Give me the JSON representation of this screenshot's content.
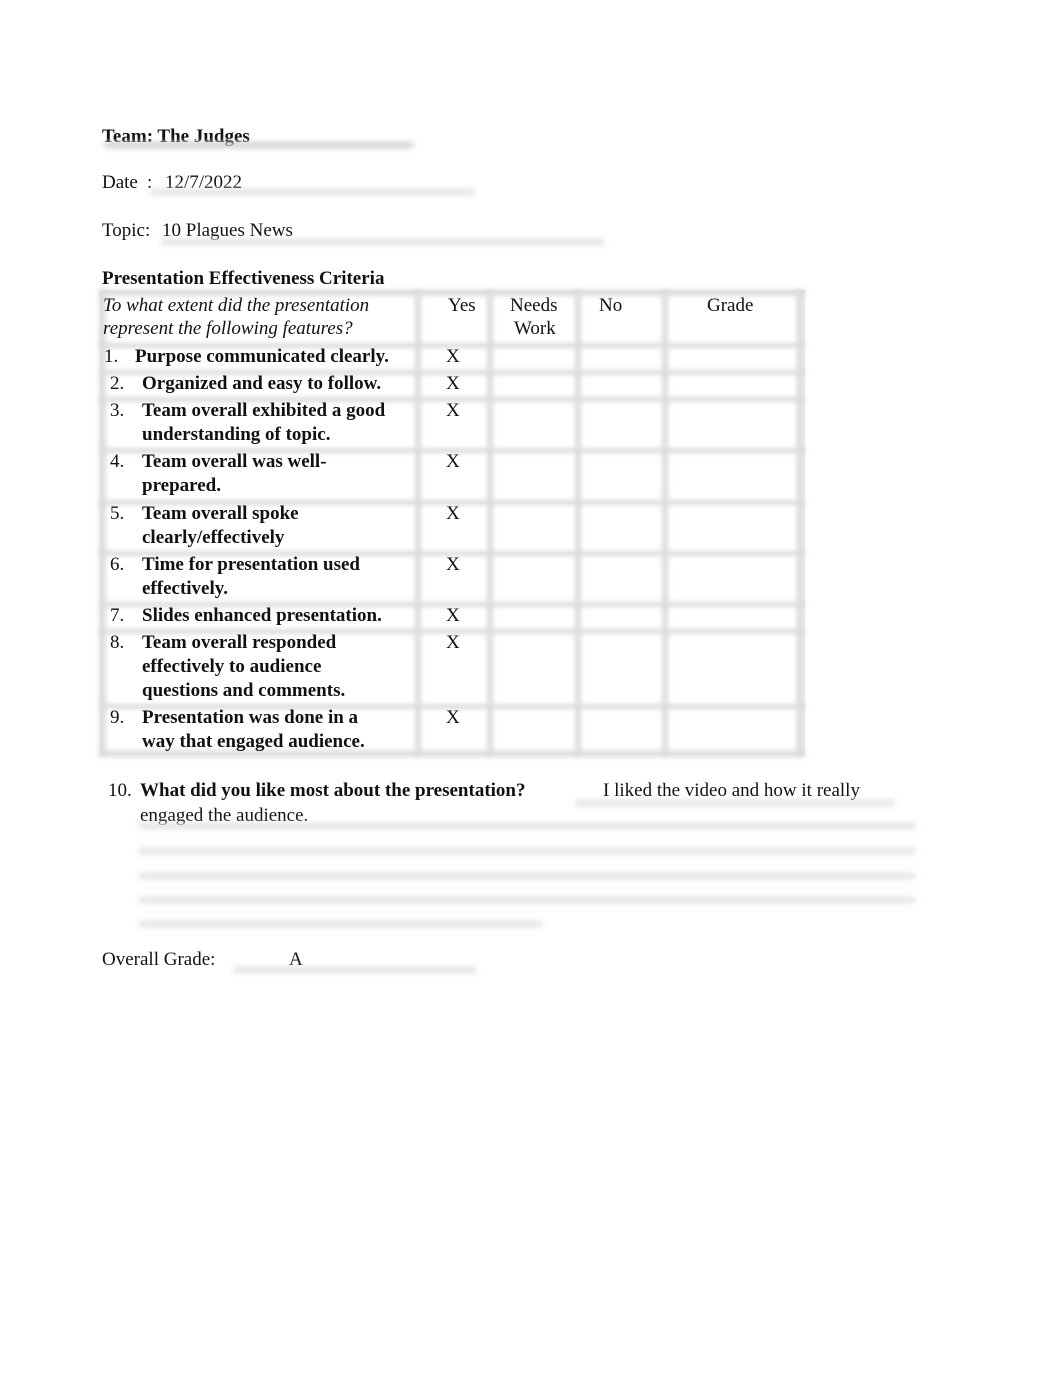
{
  "header": {
    "team_label": "Team: The Judges",
    "date_label": "Date",
    "date_sep": ":",
    "date_value": "12/7/2022",
    "topic_label": "Topic:",
    "topic_value": "10 Plagues News"
  },
  "table": {
    "title": "Presentation Effectiveness Criteria",
    "question_line1": "To what extent did the presentation",
    "question_line2": "represent the following features?",
    "columns": {
      "yes": "Yes",
      "needs_work_1": "Needs",
      "needs_work_2": "Work",
      "no": "No",
      "grade": "Grade"
    },
    "rows": [
      {
        "num": "1.",
        "lines": [
          "Purpose communicated clearly."
        ],
        "yes": "X",
        "needs_work": "",
        "no": "",
        "grade": ""
      },
      {
        "num": "2.",
        "lines": [
          "Organized and easy to follow."
        ],
        "yes": "X",
        "needs_work": "",
        "no": "",
        "grade": ""
      },
      {
        "num": "3.",
        "lines": [
          "Team overall exhibited a good",
          "understanding of topic."
        ],
        "yes": "X",
        "needs_work": "",
        "no": "",
        "grade": ""
      },
      {
        "num": "4.",
        "lines": [
          "Team overall was well-",
          "prepared."
        ],
        "yes": "X",
        "needs_work": "",
        "no": "",
        "grade": ""
      },
      {
        "num": "5.",
        "lines": [
          "Team overall spoke",
          "clearly/effectively"
        ],
        "yes": "X",
        "needs_work": "",
        "no": "",
        "grade": ""
      },
      {
        "num": "6.",
        "lines": [
          "Time for presentation used",
          "effectively."
        ],
        "yes": "X",
        "needs_work": "",
        "no": "",
        "grade": ""
      },
      {
        "num": "7.",
        "lines": [
          "Slides enhanced presentation."
        ],
        "yes": "X",
        "needs_work": "",
        "no": "",
        "grade": ""
      },
      {
        "num": "8.",
        "lines": [
          "Team overall responded",
          "effectively to audience",
          "questions and comments."
        ],
        "yes": "X",
        "needs_work": "",
        "no": "",
        "grade": ""
      },
      {
        "num": "9.",
        "lines": [
          "Presentation was done in a",
          "way that engaged audience."
        ],
        "yes": "X",
        "needs_work": "",
        "no": "",
        "grade": ""
      }
    ]
  },
  "question10": {
    "num": "10.",
    "prompt": "What did you like most about the presentation?",
    "answer_line1": "I liked the video and how it really",
    "answer_line2": "engaged the audience."
  },
  "overall": {
    "label": "Overall Grade:",
    "value": "A"
  }
}
